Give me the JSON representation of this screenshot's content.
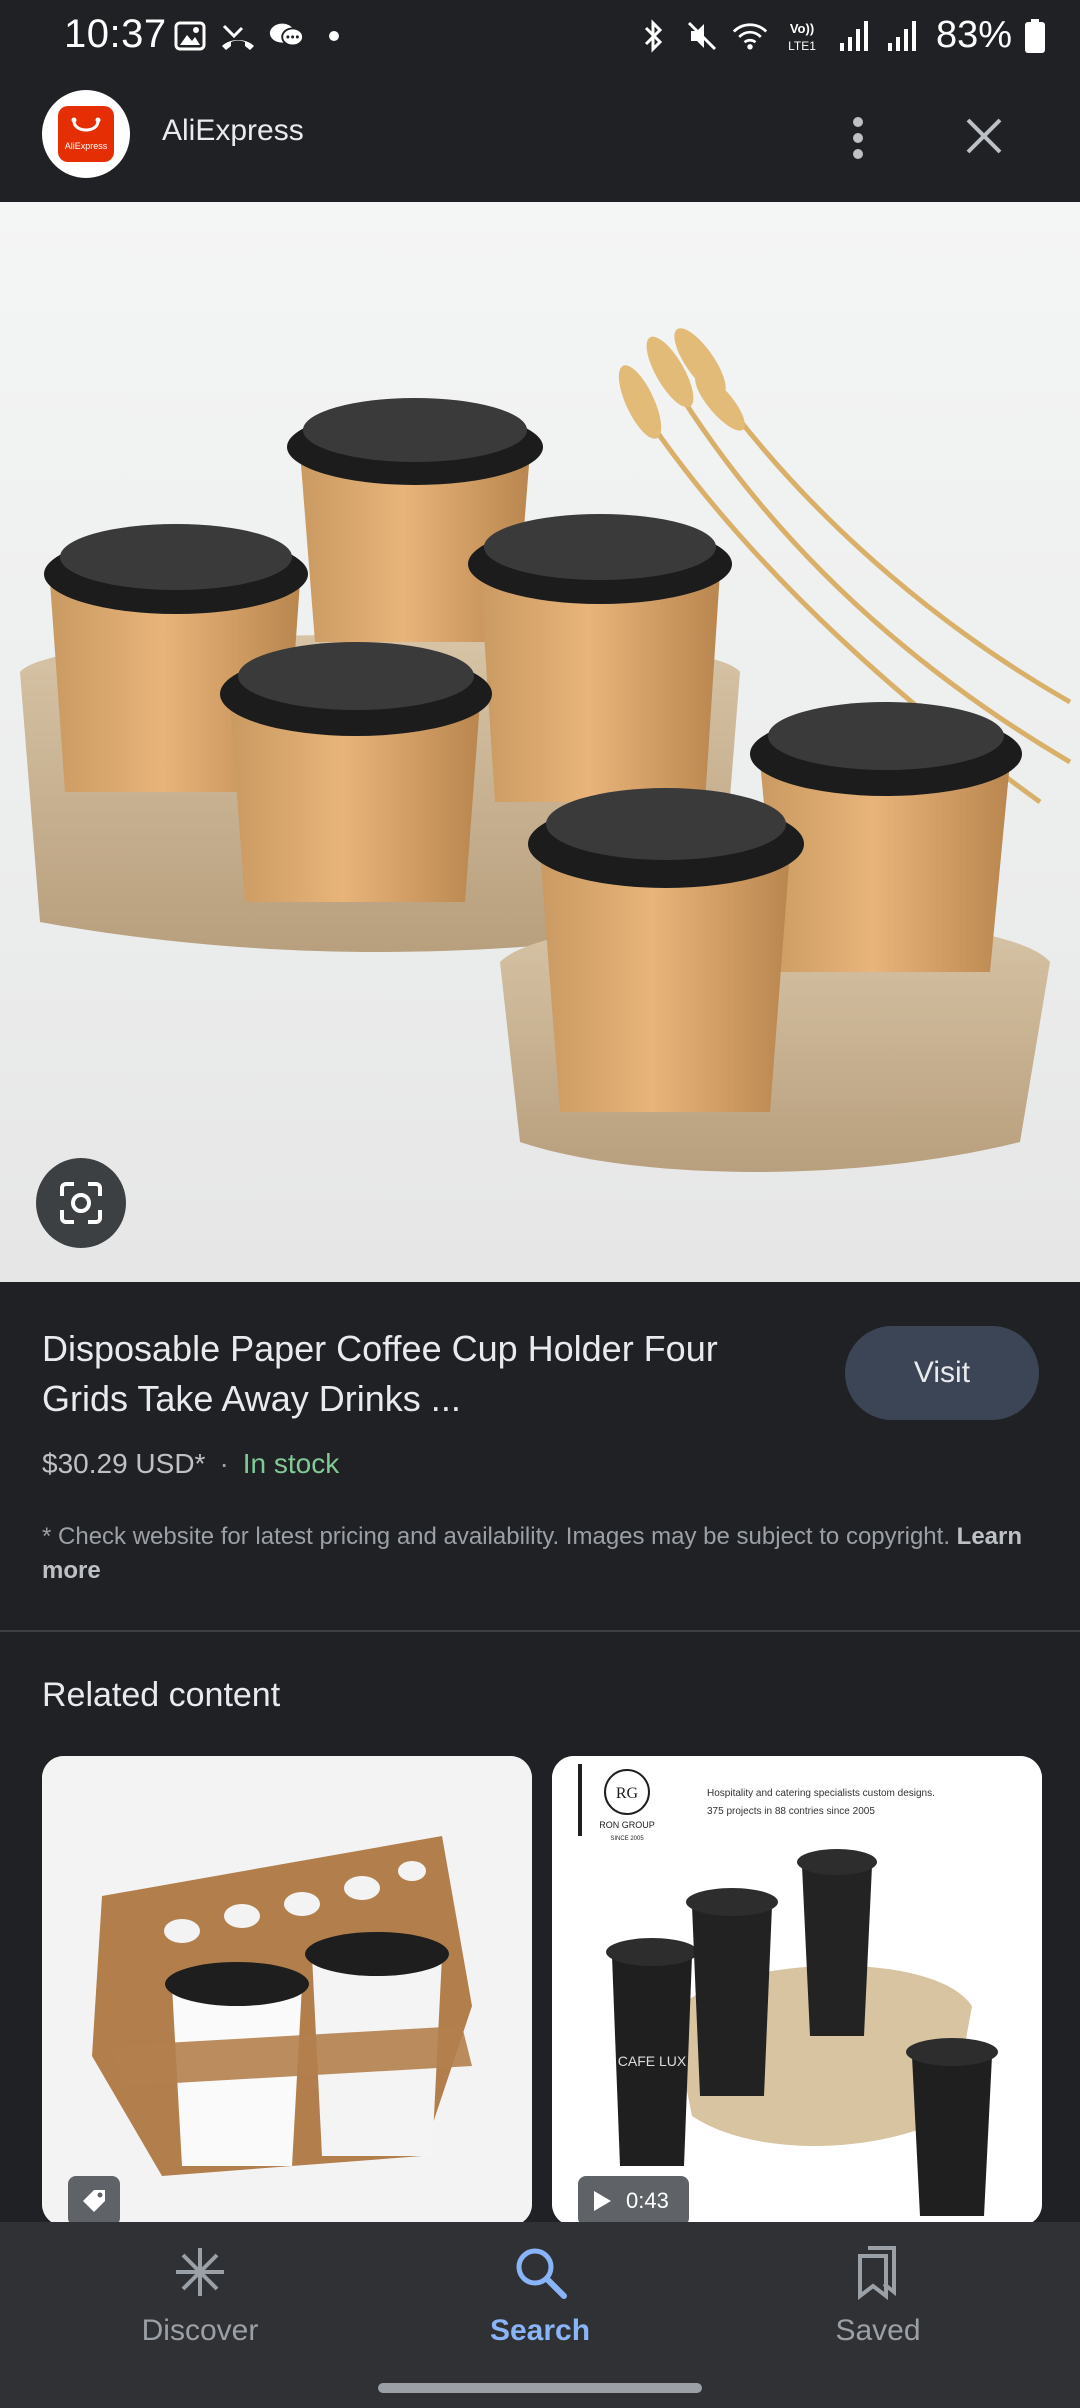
{
  "status_bar": {
    "time": "10:37",
    "battery": "83%",
    "icons_left": [
      "gallery-icon",
      "missed-call-icon",
      "chat-icon",
      "dot-icon"
    ],
    "icons_right": [
      "bluetooth-icon",
      "mute-icon",
      "wifi-icon",
      "volte-icon",
      "signal-icon",
      "signal-icon",
      "battery-icon"
    ],
    "volte_label": "Vo)) LTE1"
  },
  "header": {
    "app_name": "AliExpress",
    "logo_text": "AliExpress"
  },
  "product": {
    "title": "Disposable Paper Coffee Cup Holder Four Grids Take Away Drinks ...",
    "visit_label": "Visit",
    "price": "$30.29 USD*",
    "separator": "·",
    "stock": "In stock",
    "disclaimer": "* Check website for latest pricing and availability. Images may be subject to copyright.",
    "learn_more": "Learn more"
  },
  "related": {
    "title": "Related content",
    "cards": [
      {
        "badge": "tag-icon"
      },
      {
        "badge_duration": "0:43",
        "brand": "RON GROUP",
        "brand_sub": "SINCE 2005",
        "tagline_1": "Hospitality and catering specialists custom designs.",
        "tagline_2": "375 projects in 88 contries since 2005",
        "cup_text": "CAFE LUX"
      }
    ]
  },
  "bottom_nav": {
    "items": [
      {
        "label": "Discover",
        "icon": "asterisk-icon"
      },
      {
        "label": "Search",
        "icon": "search-icon",
        "active": true
      },
      {
        "label": "Saved",
        "icon": "bookmark-icon"
      }
    ]
  },
  "colors": {
    "background": "#202124",
    "accent": "#8ab4f8",
    "stock_green": "#81c995",
    "visit_button": "#3c4556",
    "brand_red": "#e62e04"
  }
}
